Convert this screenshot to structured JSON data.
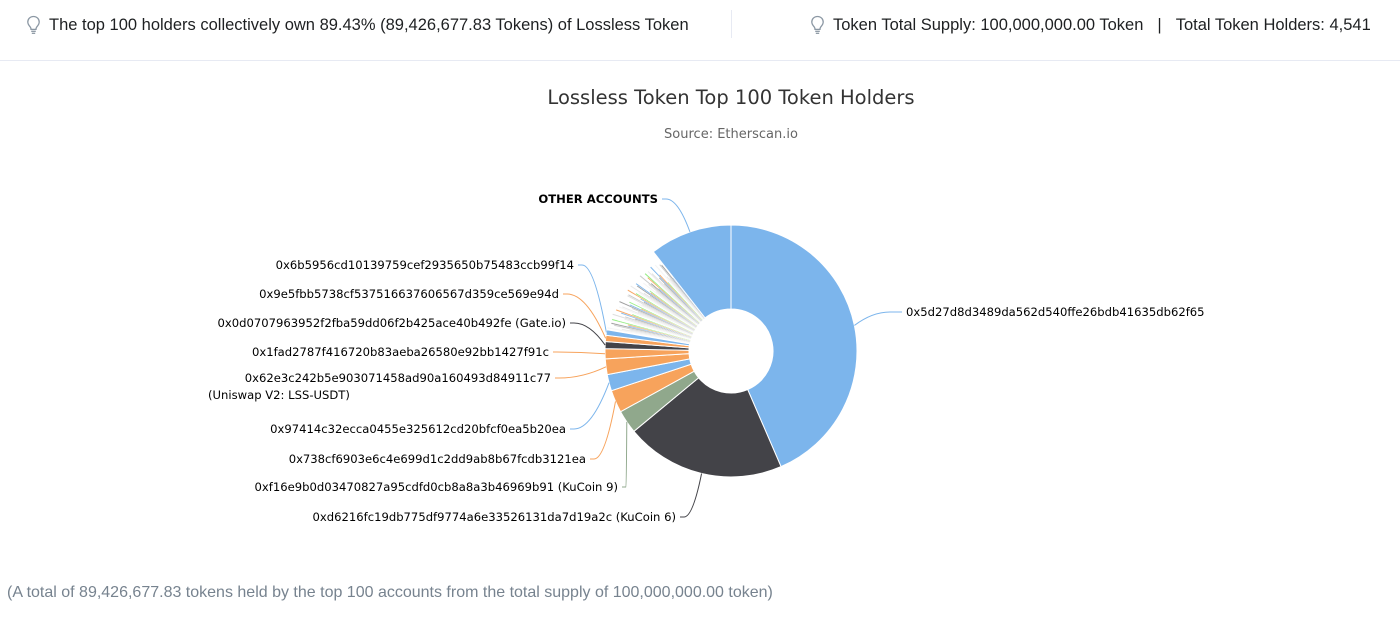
{
  "summary": {
    "left_text": "The top 100 holders collectively own 89.43% (89,426,677.83 Tokens) of Lossless Token",
    "supply_text": "Token Total Supply: 100,000,000.00 Token",
    "separator": "|",
    "holders_text": "Total Token Holders: 4,541"
  },
  "footer_note": "(A total of 89,426,677.83 tokens held by the top 100 accounts from the total supply of 100,000,000.00 token)",
  "colors": {
    "blue": "#7cb5ec",
    "dark": "#434348",
    "green": "#90a88c",
    "orange": "#f7a35c",
    "connector": "#7cb5ec"
  },
  "chart_data": {
    "type": "pie",
    "variant": "donut",
    "title": "Lossless Token Top 100 Token Holders",
    "subtitle": "Source: Etherscan.io",
    "slices": [
      {
        "name": "0x5d27d8d3489da562d540ffe26bdb41635db62f65",
        "value": 43.5,
        "color": "#7cb5ec",
        "labeled": true
      },
      {
        "name": "0xd6216fc19db775df9774a6e33526131da7d19a2c (KuCoin 6)",
        "value": 20.5,
        "color": "#434348",
        "labeled": true
      },
      {
        "name": "0xf16e9b0d03470827a95cdfd0cb8a8a3b46969b91 (KuCoin 9)",
        "value": 3.0,
        "color": "#90a88c",
        "labeled": true
      },
      {
        "name": "0x738cf6903e6c4e699d1c2dd9ab8b67fcdb3121ea",
        "value": 2.9,
        "color": "#f7a35c",
        "labeled": true
      },
      {
        "name": "0x97414c32ecca0455e325612cd20bfcf0ea5b20ea",
        "value": 2.1,
        "color": "#7cb5ec",
        "labeled": true
      },
      {
        "name": "0x62e3c242b5e903071458ad90a160493d84911c77 (Uniswap V2: LSS-USDT)",
        "value": 2.0,
        "color": "#f7a35c",
        "labeled": true
      },
      {
        "name": "0x1fad2787f416720b83aeba26580e92bb1427f91c",
        "value": 1.3,
        "color": "#f7a35c",
        "labeled": true
      },
      {
        "name": "0x0d0707963952f2fba59dd06f2b425ace40b492fe (Gate.io)",
        "value": 0.9,
        "color": "#434348",
        "labeled": true
      },
      {
        "name": "0x9e5fbb5738cf537516637606567d359ce569e94d",
        "value": 0.8,
        "color": "#f7a35c",
        "labeled": true
      },
      {
        "name": "0x6b5956cd10139759cef2935650b75483ccb99f14",
        "value": 0.7,
        "color": "#7cb5ec",
        "labeled": true
      },
      {
        "name": "",
        "value": 11.73,
        "color": "#cccccc",
        "labeled": false,
        "note": "remaining top-100 accounts"
      },
      {
        "name": "OTHER ACCOUNTS",
        "value": 10.57,
        "color": "#7cb5ec",
        "labeled": true
      }
    ]
  }
}
